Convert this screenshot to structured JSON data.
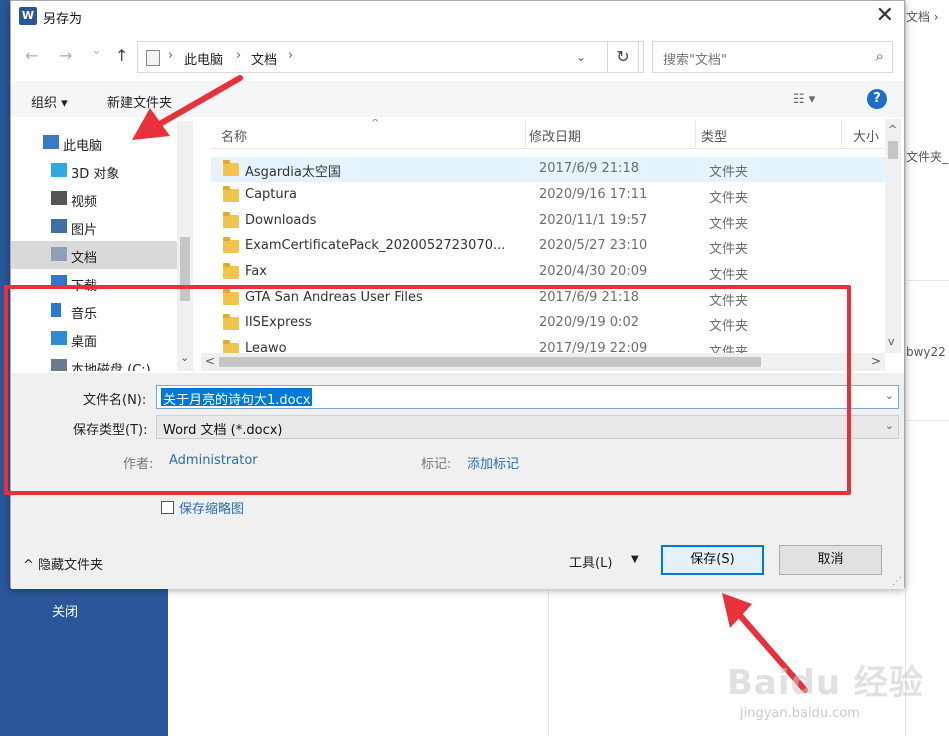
{
  "dialog": {
    "title": "另存为",
    "app_icon_letter": "W",
    "close_glyph": "✕"
  },
  "nav": {
    "back": "←",
    "forward": "→",
    "recent": "⌄",
    "up": "↑",
    "crumbs": [
      "此电脑",
      "文档"
    ],
    "crumb_sep": "›",
    "address_dropdown": "⌄",
    "refresh": "↻",
    "search_placeholder": "搜索\"文档\"",
    "search_icon": "⌕"
  },
  "toolbar": {
    "organize": "组织 ▾",
    "new_folder": "新建文件夹",
    "view_icon": "☷ ▾",
    "help": "?"
  },
  "sidebar": {
    "items": [
      {
        "label": "此电脑",
        "icon": "pc-icon",
        "color": "#3a78c4"
      },
      {
        "label": "3D 对象",
        "icon": "3d-objects-icon",
        "color": "#2fa9df"
      },
      {
        "label": "视频",
        "icon": "video-icon",
        "color": "#555555"
      },
      {
        "label": "图片",
        "icon": "pictures-icon",
        "color": "#3e6fa8"
      },
      {
        "label": "文档",
        "icon": "documents-icon",
        "color": "#8da0b5"
      },
      {
        "label": "下载",
        "icon": "downloads-icon",
        "color": "#2f77c9"
      },
      {
        "label": "音乐",
        "icon": "music-icon",
        "color": "#2f77c9"
      },
      {
        "label": "桌面",
        "icon": "desktop-icon",
        "color": "#2f8bd6"
      },
      {
        "label": "本地磁盘 (C:)",
        "icon": "disk-icon",
        "color": "#6b7b8c"
      }
    ],
    "selected_index": 4
  },
  "filelist": {
    "columns": [
      "名称",
      "修改日期",
      "类型",
      "大小"
    ],
    "sort_glyph": "^",
    "rows": [
      {
        "name": "Asgardia太空国",
        "date": "2017/6/9 21:18",
        "type": "文件夹"
      },
      {
        "name": "Captura",
        "date": "2020/9/16 17:11",
        "type": "文件夹"
      },
      {
        "name": "Downloads",
        "date": "2020/11/1 19:57",
        "type": "文件夹"
      },
      {
        "name": "ExamCertificatePack_2020052723070...",
        "date": "2020/5/27 23:10",
        "type": "文件夹"
      },
      {
        "name": "Fax",
        "date": "2020/4/30 20:09",
        "type": "文件夹"
      },
      {
        "name": "GTA San Andreas User Files",
        "date": "2017/6/9 21:18",
        "type": "文件夹"
      },
      {
        "name": "IISExpress",
        "date": "2020/9/19 0:02",
        "type": "文件夹"
      },
      {
        "name": "Leawo",
        "date": "2017/9/19 22:09",
        "type": "文件夹"
      }
    ],
    "selected_index": 0
  },
  "scroll": {
    "up": "^",
    "down": "v",
    "left": "<",
    "right": ">",
    "nav_down": "⌄"
  },
  "form": {
    "filename_label": "文件名(N):",
    "filename_value": "关于月亮的诗句大1.docx",
    "filetype_label": "保存类型(T):",
    "filetype_value": "Word 文档 (*.docx)",
    "dd_caret": "⌄",
    "author_label": "作者:",
    "author_value": "Administrator",
    "tags_label": "标记:",
    "tags_value": "添加标记",
    "thumbnail_label": "保存缩略图",
    "hide_folders": "^ 隐藏文件夹",
    "tools": "工具(L)",
    "tools_caret": "▼",
    "save": "保存(S)",
    "cancel": "取消",
    "grip": "⋰"
  },
  "background": {
    "close_label": "关闭",
    "right_texts": [
      "文档 ›",
      "文件夹_",
      "bwy22"
    ]
  },
  "watermark": {
    "brand": "Baidu 经验",
    "url": "jingyan.baidu.com"
  },
  "colors": {
    "word_blue": "#2b579a",
    "accent": "#0078d7",
    "annotation_red": "#e8313a"
  }
}
